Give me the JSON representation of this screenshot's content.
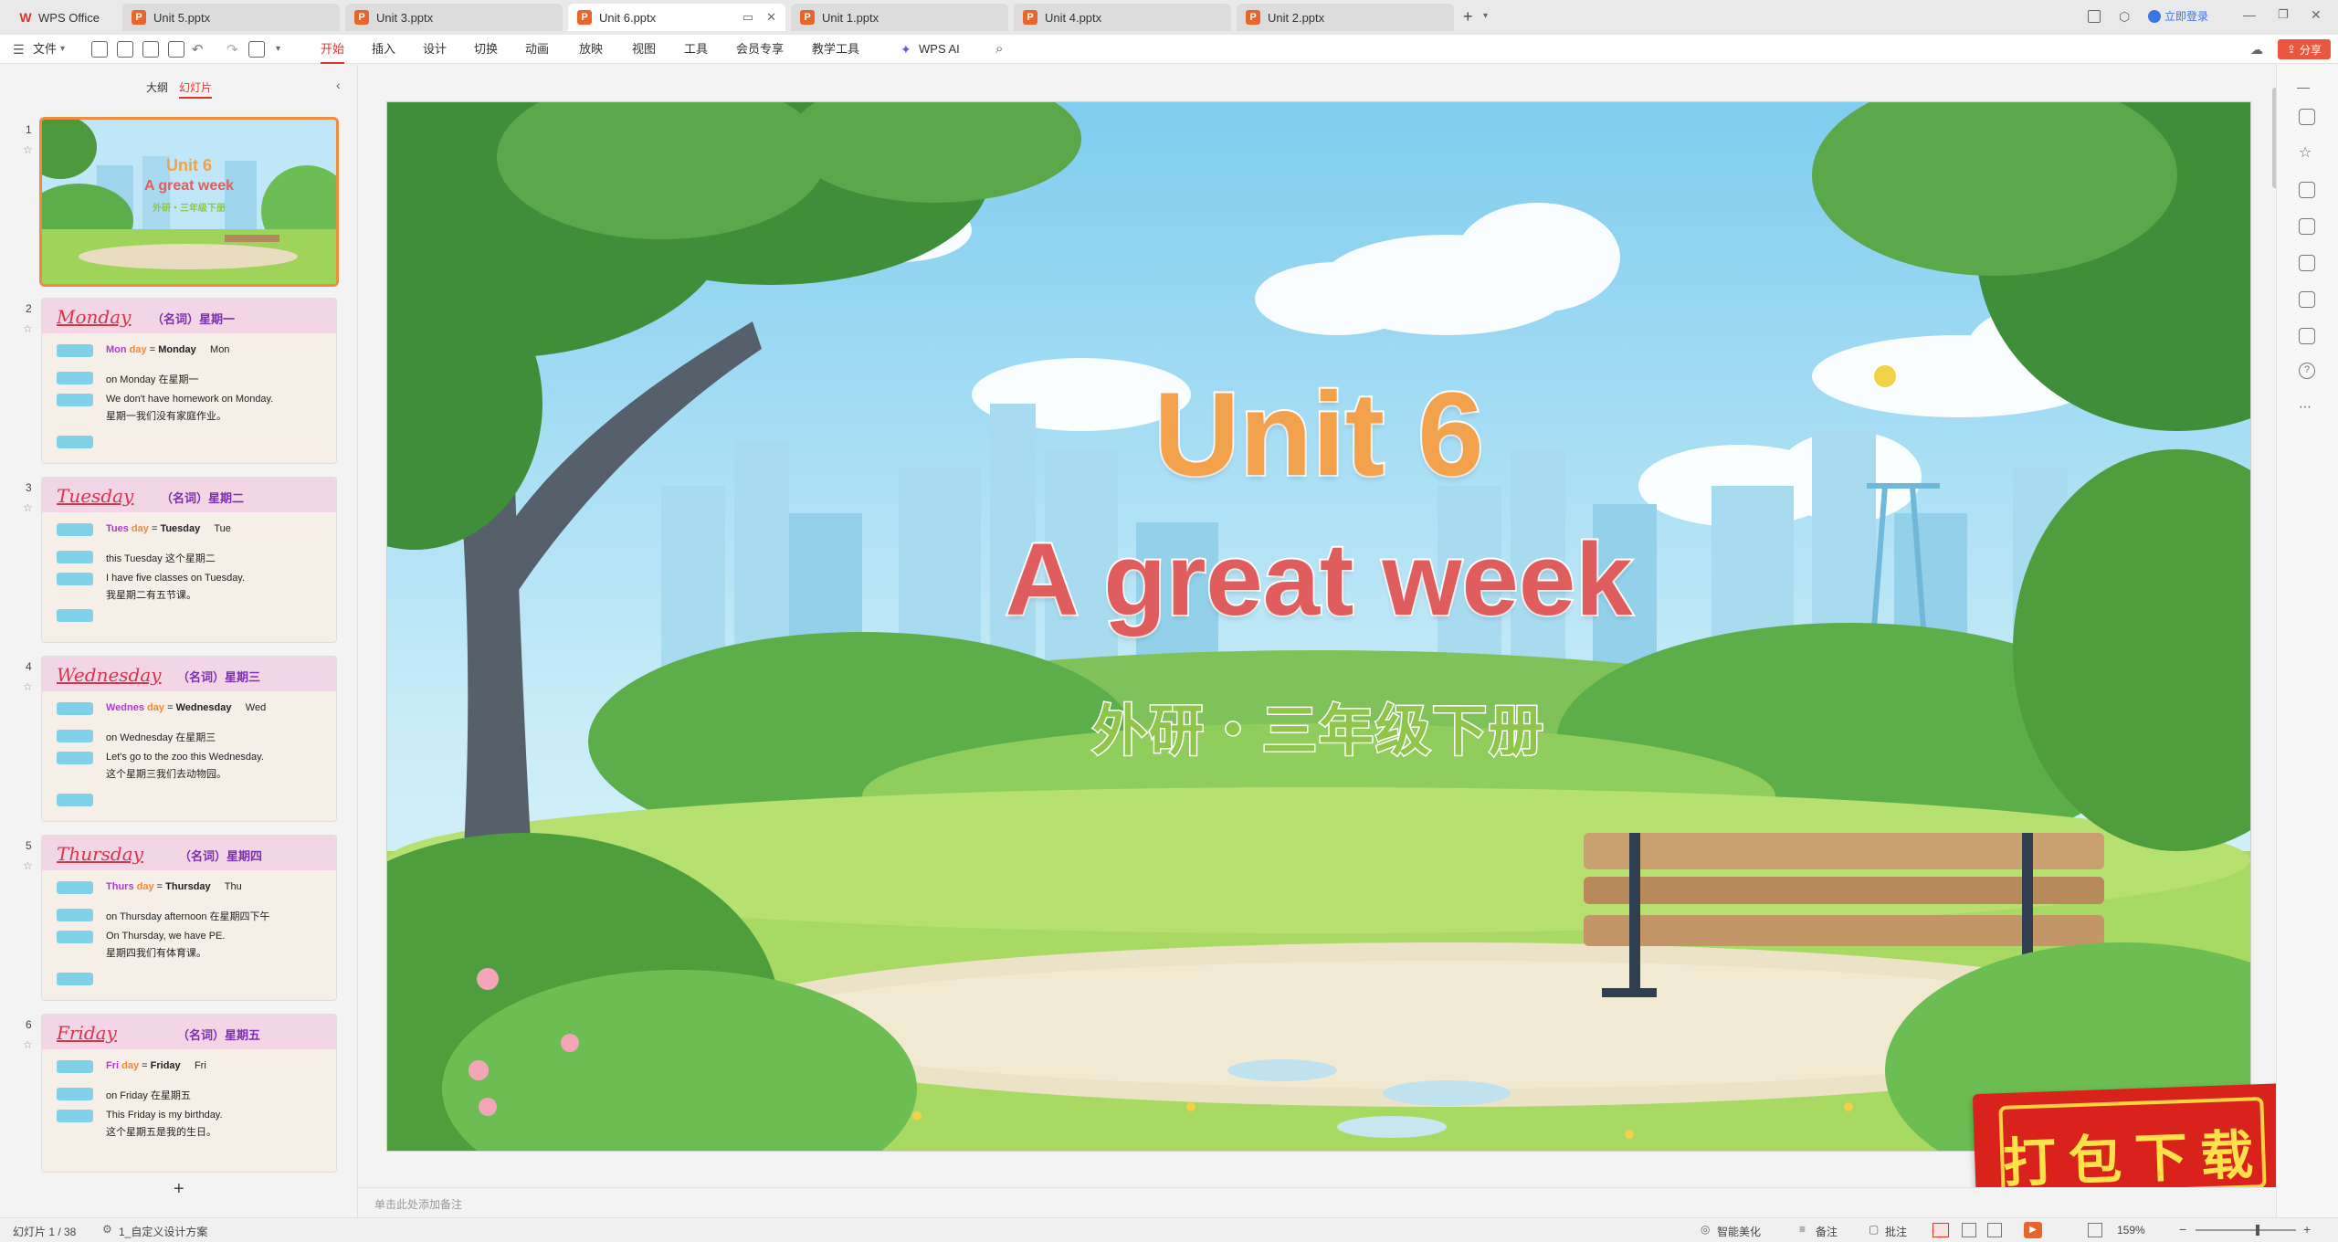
{
  "tabbar": {
    "wps_label": "WPS Office",
    "tabs": [
      {
        "label": "Unit 5.pptx"
      },
      {
        "label": "Unit 3.pptx"
      },
      {
        "label": "Unit 6.pptx"
      },
      {
        "label": "Unit 1.pptx"
      },
      {
        "label": "Unit 4.pptx"
      },
      {
        "label": "Unit 2.pptx"
      }
    ],
    "new_tab": "+",
    "login_label": "立即登录"
  },
  "menubar": {
    "file_label": "文件",
    "items": [
      "开始",
      "插入",
      "设计",
      "切换",
      "动画",
      "放映",
      "视图",
      "工具",
      "会员专享",
      "教学工具"
    ],
    "wps_ai": "WPS AI",
    "share_label": "分享"
  },
  "leftpanel": {
    "tab_outline": "大纲",
    "tab_slides": "幻灯片",
    "add_label": "+",
    "thumbs": [
      {
        "num": "1",
        "title": "Unit 6",
        "subtitle": "A great week",
        "cn": "外研・三年级下册"
      },
      {
        "num": "2",
        "word": "Monday",
        "cn": "（名词）星期一",
        "parts": [
          "Mon",
          "day",
          "Monday",
          "Mon"
        ],
        "ex1": "on Monday 在星期一",
        "ex2": "We don't have homework on Monday.",
        "ex3": "星期一我们没有家庭作业。"
      },
      {
        "num": "3",
        "word": "Tuesday",
        "cn": "（名词）星期二",
        "parts": [
          "Tues",
          "day",
          "Tuesday",
          "Tue"
        ],
        "ex1": "this Tuesday 这个星期二",
        "ex2": "I have five classes on Tuesday.",
        "ex3": "我星期二有五节课。"
      },
      {
        "num": "4",
        "word": "Wednesday",
        "cn": "（名词）星期三",
        "parts": [
          "Wednes",
          "day",
          "Wednesday",
          "Wed"
        ],
        "ex1": "on Wednesday 在星期三",
        "ex2": "Let's go to the zoo this Wednesday.",
        "ex3": "这个星期三我们去动物园。"
      },
      {
        "num": "5",
        "word": "Thursday",
        "cn": "（名词）星期四",
        "parts": [
          "Thurs",
          "day",
          "Thursday",
          "Thu"
        ],
        "ex1": "on Thursday afternoon 在星期四下午",
        "ex2": "On Thursday, we have PE.",
        "ex3": "星期四我们有体育课。"
      },
      {
        "num": "6",
        "word": "Friday",
        "cn": "（名词）星期五",
        "parts": [
          "Fri",
          "day",
          "Friday",
          "Fri"
        ],
        "ex1": "on Friday 在星期五",
        "ex2": "This Friday is my birthday.",
        "ex3": "这个星期五是我的生日。"
      }
    ]
  },
  "slide": {
    "title": "Unit 6",
    "subtitle": "A great week",
    "cn_subtitle": "外研・三年级下册"
  },
  "notes": {
    "placeholder": "单击此处添加备注"
  },
  "download_badge": {
    "text": "打包下载"
  },
  "statusbar": {
    "slide_info": "幻灯片 1 / 38",
    "theme": "1_自定义设计方案",
    "beautify": "智能美化",
    "notes_label": "备注",
    "comment_label": "批注",
    "zoom": "159%"
  },
  "colors": {
    "accent": "#d9362c",
    "title_orange": "#f2a24c",
    "subtitle_red": "#e05d5d",
    "cn_green": "#8fc64a"
  }
}
